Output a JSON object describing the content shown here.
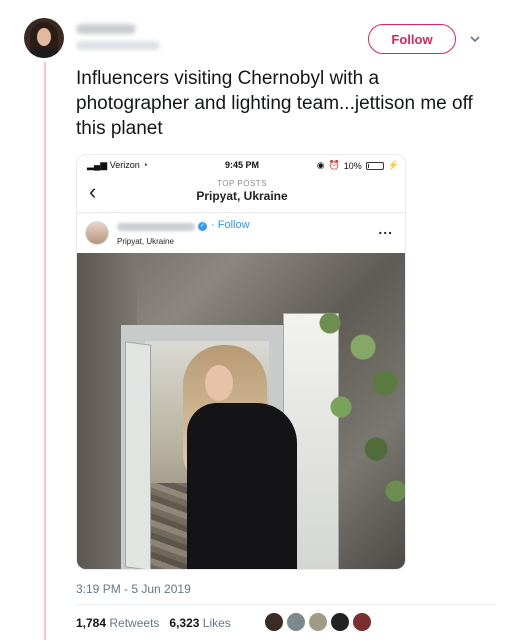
{
  "tweet": {
    "follow_label": "Follow",
    "text": "Influencers visiting Chernobyl with a photographer and lighting team...jettison me off this planet",
    "timestamp": "3:19 PM - 5 Jun 2019",
    "stats": {
      "retweets_count": "1,784",
      "retweets_label": "Retweets",
      "likes_count": "6,323",
      "likes_label": "Likes"
    }
  },
  "phone": {
    "carrier": "Verizon",
    "time": "9:45 PM",
    "battery_percent": "10%",
    "battery_level": 0.1,
    "icons": [
      "signal-icon",
      "wifi-icon",
      "location-icon",
      "alarm-icon",
      "battery-icon",
      "charging-icon"
    ]
  },
  "instagram": {
    "header_label": "TOP POSTS",
    "place": "Pripyat, Ukraine",
    "follow_label": "Follow",
    "post_location": "Pripyat, Ukraine",
    "more_label": "...",
    "verified_icon": "verified-icon"
  },
  "colors": {
    "brand_pink": "#e0245e",
    "ig_blue": "#3897f0",
    "muted": "#657786"
  }
}
